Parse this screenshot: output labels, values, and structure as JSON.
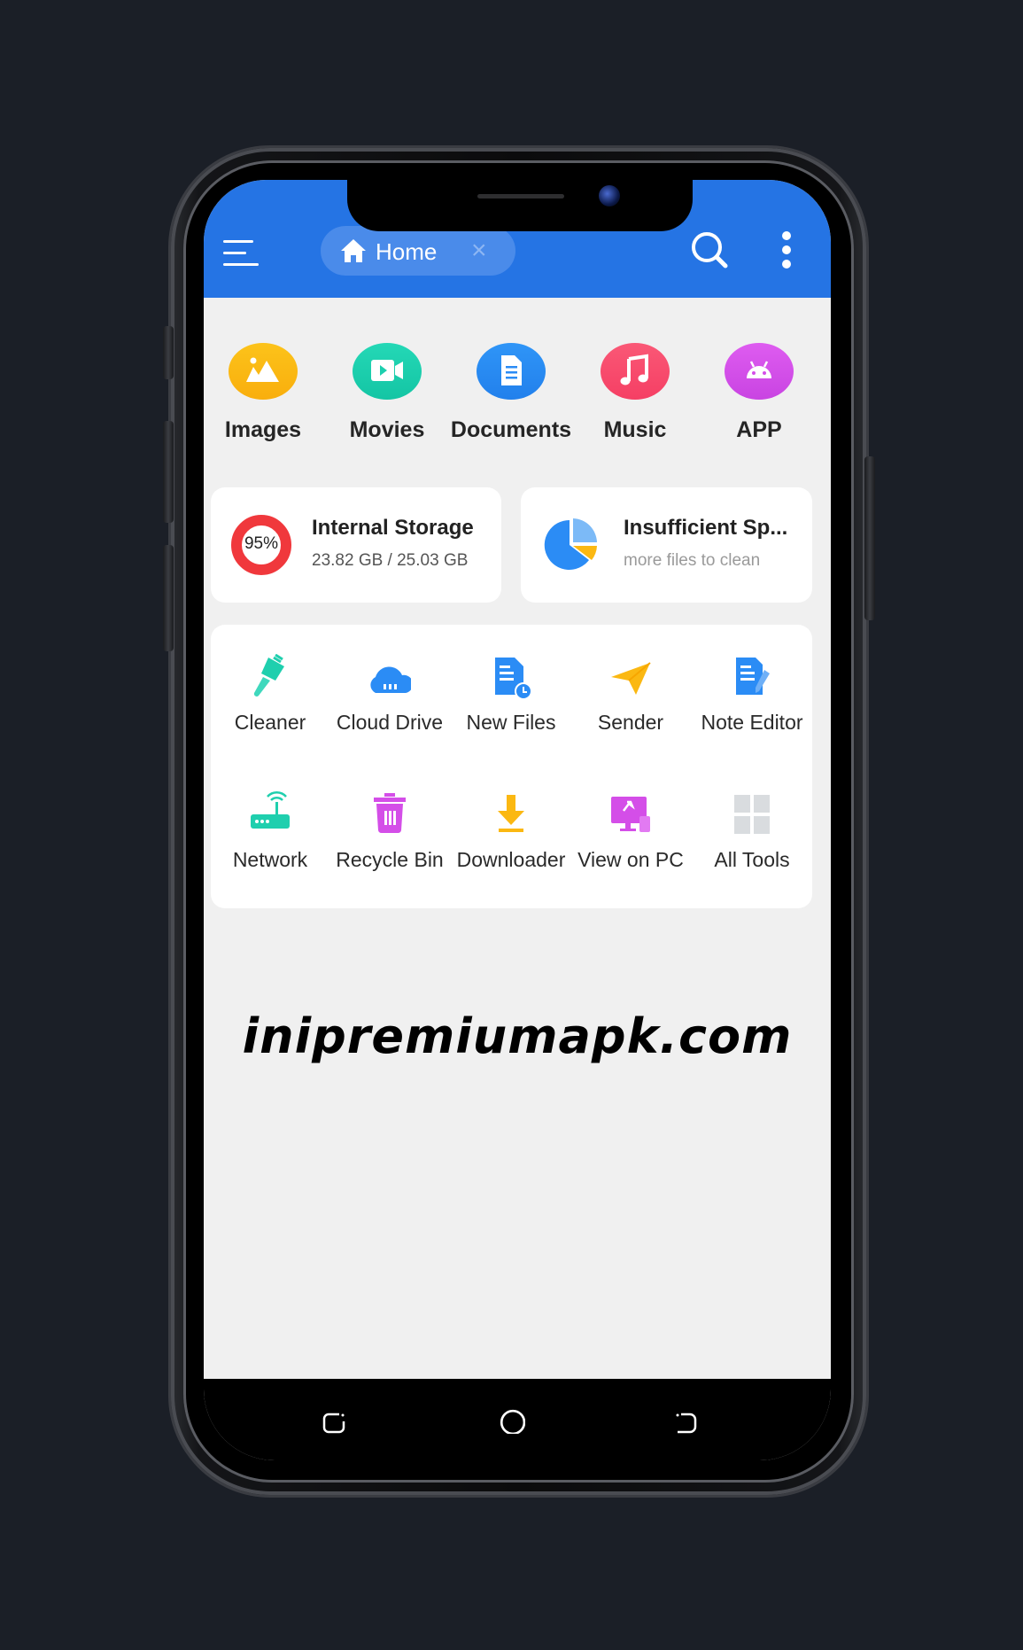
{
  "colors": {
    "appbar": "#2574e4",
    "background": "#f0f0f0",
    "images": "#fbb812",
    "movies": "#1ccfae",
    "documents": "#2b8cf5",
    "music": "#f94d6e",
    "app": "#d44ee8",
    "storage_ring": "#f0383c"
  },
  "header": {
    "menu_icon": "hamburger-menu-icon",
    "tab_label": "Home",
    "tab_icon": "home-icon",
    "tab_close": "×",
    "search_icon": "search-icon",
    "more_icon": "more-vertical-icon"
  },
  "categories": [
    {
      "label": "Images",
      "icon": "image-icon"
    },
    {
      "label": "Movies",
      "icon": "video-camera-icon"
    },
    {
      "label": "Documents",
      "icon": "document-icon"
    },
    {
      "label": "Music",
      "icon": "music-note-icon"
    },
    {
      "label": "APP",
      "icon": "android-icon"
    }
  ],
  "storage": {
    "title": "Internal Storage",
    "used": "23.82 GB",
    "total": "25.03 GB",
    "summary": "23.82 GB / 25.03 GB",
    "percent_label": "95%",
    "percent": 95
  },
  "cleanup": {
    "title": "Insufficient Sp...",
    "subtitle": "more files to clean"
  },
  "tools": [
    {
      "label": "Cleaner",
      "icon": "broom-icon"
    },
    {
      "label": "Cloud Drive",
      "icon": "cloud-icon"
    },
    {
      "label": "New Files",
      "icon": "new-file-clock-icon"
    },
    {
      "label": "Sender",
      "icon": "paper-plane-icon"
    },
    {
      "label": "Note Editor",
      "icon": "note-edit-icon"
    },
    {
      "label": "Network",
      "icon": "router-icon"
    },
    {
      "label": "Recycle Bin",
      "icon": "trash-icon"
    },
    {
      "label": "Downloader",
      "icon": "download-icon"
    },
    {
      "label": "View on PC",
      "icon": "monitor-icon"
    },
    {
      "label": "All Tools",
      "icon": "grid-icon"
    }
  ],
  "watermark": "inipremiumapk.com",
  "navbar": {
    "recents_icon": "recents-icon",
    "home_icon": "home-circle-icon",
    "back_icon": "back-icon"
  }
}
